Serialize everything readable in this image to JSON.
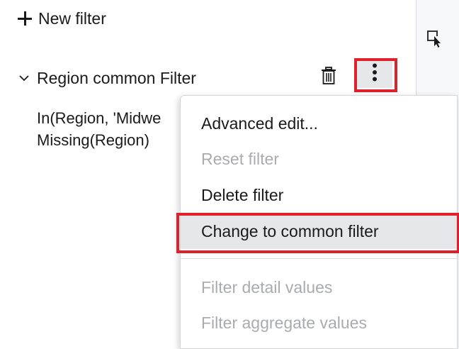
{
  "panel": {
    "new_filter_label": "New filter",
    "filter": {
      "title": "Region common Filter",
      "expression_line1": "In(Region, 'Midwe",
      "expression_line2": "Missing(Region)"
    }
  },
  "menu": {
    "items": [
      {
        "label": "Advanced edit...",
        "enabled": true
      },
      {
        "label": "Reset filter",
        "enabled": false
      },
      {
        "label": "Delete filter",
        "enabled": true
      },
      {
        "label": "Change to common filter",
        "enabled": true,
        "hovered": true
      },
      {
        "label": "Filter detail values",
        "enabled": false
      },
      {
        "label": "Filter aggregate values",
        "enabled": false
      }
    ]
  },
  "icons": {
    "add": "plus-icon",
    "expand": "chevron-down-icon",
    "delete": "trash-icon",
    "more": "vertical-ellipsis-icon",
    "select": "select-cursor-icon"
  },
  "colors": {
    "highlight": "#e0202a",
    "hover": "#e6e7ea",
    "disabled_text": "#a9abaf"
  }
}
